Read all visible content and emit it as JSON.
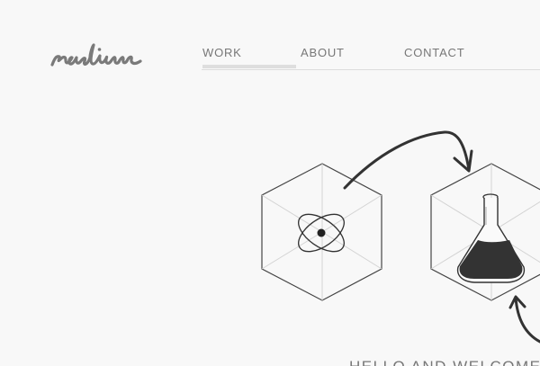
{
  "brand": {
    "logo_text": "radium"
  },
  "nav": {
    "items": [
      {
        "label": "WORK",
        "active": true
      },
      {
        "label": "ABOUT",
        "active": false
      },
      {
        "label": "CONTACT",
        "active": false
      }
    ]
  },
  "hero": {
    "icons": [
      "atom-icon",
      "flask-icon",
      "curved-arrow-icon"
    ],
    "welcome_text": "HELLO AND WELCOME T"
  },
  "colors": {
    "background": "#f8f8f8",
    "text": "#777777",
    "line": "#333333",
    "faint_line": "#cccccc"
  }
}
